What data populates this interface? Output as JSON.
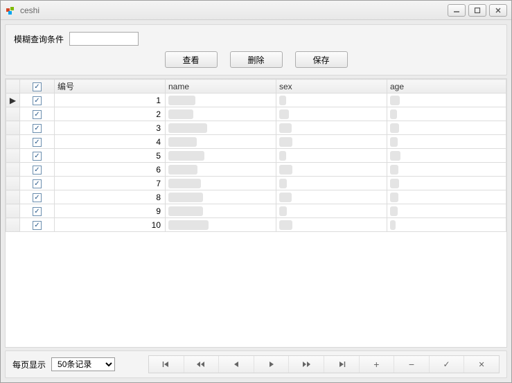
{
  "window": {
    "title": "ceshi"
  },
  "search": {
    "label": "模糊查询条件",
    "value": ""
  },
  "buttons": {
    "view": "查看",
    "delete": "删除",
    "save": "保存"
  },
  "grid": {
    "headers": {
      "id": "编号",
      "name": "name",
      "sex": "sex",
      "age": "age"
    },
    "rows": [
      {
        "checked": true,
        "id": "1"
      },
      {
        "checked": true,
        "id": "2"
      },
      {
        "checked": true,
        "id": "3"
      },
      {
        "checked": true,
        "id": "4"
      },
      {
        "checked": true,
        "id": "5"
      },
      {
        "checked": true,
        "id": "6"
      },
      {
        "checked": true,
        "id": "7"
      },
      {
        "checked": true,
        "id": "8"
      },
      {
        "checked": true,
        "id": "9"
      },
      {
        "checked": true,
        "id": "10"
      }
    ],
    "header_checked": true,
    "selected_row": 0
  },
  "pager": {
    "label": "每页显示",
    "page_size": "50条记录",
    "buttons": [
      "⏮",
      "◀◀",
      "◀",
      "▶",
      "▶▶",
      "⏭",
      "+",
      "−",
      "✓",
      "✕"
    ]
  }
}
